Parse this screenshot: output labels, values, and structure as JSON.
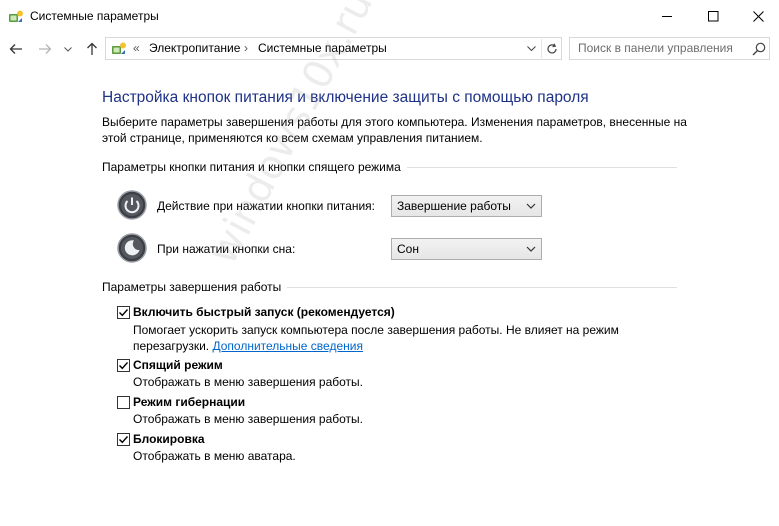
{
  "window": {
    "title": "Системные параметры",
    "controls": {
      "minimize": "minimize",
      "maximize": "maximize",
      "close": "close"
    }
  },
  "addressbar": {
    "overflow": "«",
    "breadcrumbs": [
      "Электропитание",
      "Системные параметры"
    ],
    "separator": "›"
  },
  "search": {
    "placeholder": "Поиск в панели управления"
  },
  "page": {
    "title": "Настройка кнопок питания и включение защиты с помощью пароля",
    "intro": "Выберите параметры завершения работы для этого компьютера. Изменения параметров, внесенные на этой странице, применяются ко всем схемам управления питанием."
  },
  "buttons_section": {
    "heading": "Параметры кнопки питания и кнопки спящего режима",
    "rows": [
      {
        "label": "Действие при нажатии кнопки питания:",
        "value": "Завершение работы",
        "icon": "power-button-icon"
      },
      {
        "label": "При нажатии кнопки сна:",
        "value": "Сон",
        "icon": "sleep-button-icon"
      }
    ]
  },
  "shutdown_section": {
    "heading": "Параметры завершения работы",
    "options": [
      {
        "label": "Включить быстрый запуск (рекомендуется)",
        "checked": true,
        "desc": "Помогает ускорить запуск компьютера после завершения работы. Не влияет на режим перезагрузки.",
        "link": "Дополнительные сведения"
      },
      {
        "label": "Спящий режим",
        "checked": true,
        "desc": "Отображать в меню завершения работы."
      },
      {
        "label": "Режим гибернации",
        "checked": false,
        "desc": "Отображать в меню завершения работы."
      },
      {
        "label": "Блокировка",
        "checked": true,
        "desc": "Отображать в меню аватара."
      }
    ]
  },
  "watermark": "windows10x.ru",
  "colors": {
    "title_blue": "#1e3287",
    "link_blue": "#0066cc"
  }
}
